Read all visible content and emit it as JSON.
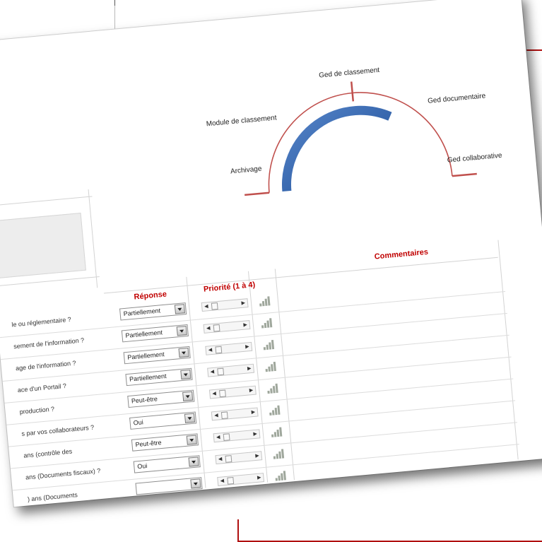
{
  "gauge": {
    "labels": {
      "archivage": "Archivage",
      "module": "Module de classement",
      "ged_classement": "Ged de classement",
      "ged_documentaire": "Ged documentaire",
      "ged_collaborative": "Ged collaborative"
    },
    "colors": {
      "track": "#c0504d",
      "fill": "#2f63ad"
    }
  },
  "table": {
    "headers": {
      "reponse": "Réponse",
      "priorite": "Priorité (1 à 4)",
      "commentaires": "Commentaires"
    },
    "rows": [
      {
        "question": "le ou réglementaire ?",
        "response": "Partiellement"
      },
      {
        "question": "sement de l'information ?",
        "response": "Partiellement"
      },
      {
        "question": "age de l'information ?",
        "response": "Partiellement"
      },
      {
        "question": "ace d'un Portail ?",
        "response": "Partiellement"
      },
      {
        "question": "production ?",
        "response": "Peut-être"
      },
      {
        "question": "s par vos collaborateurs ?",
        "response": "Oui"
      },
      {
        "question": "ans (contrôle des",
        "response": "Peut-être"
      },
      {
        "question": "ans (Documents fiscaux) ?",
        "response": "Oui"
      },
      {
        "question": ") ans (Documents",
        "response": ""
      }
    ]
  }
}
